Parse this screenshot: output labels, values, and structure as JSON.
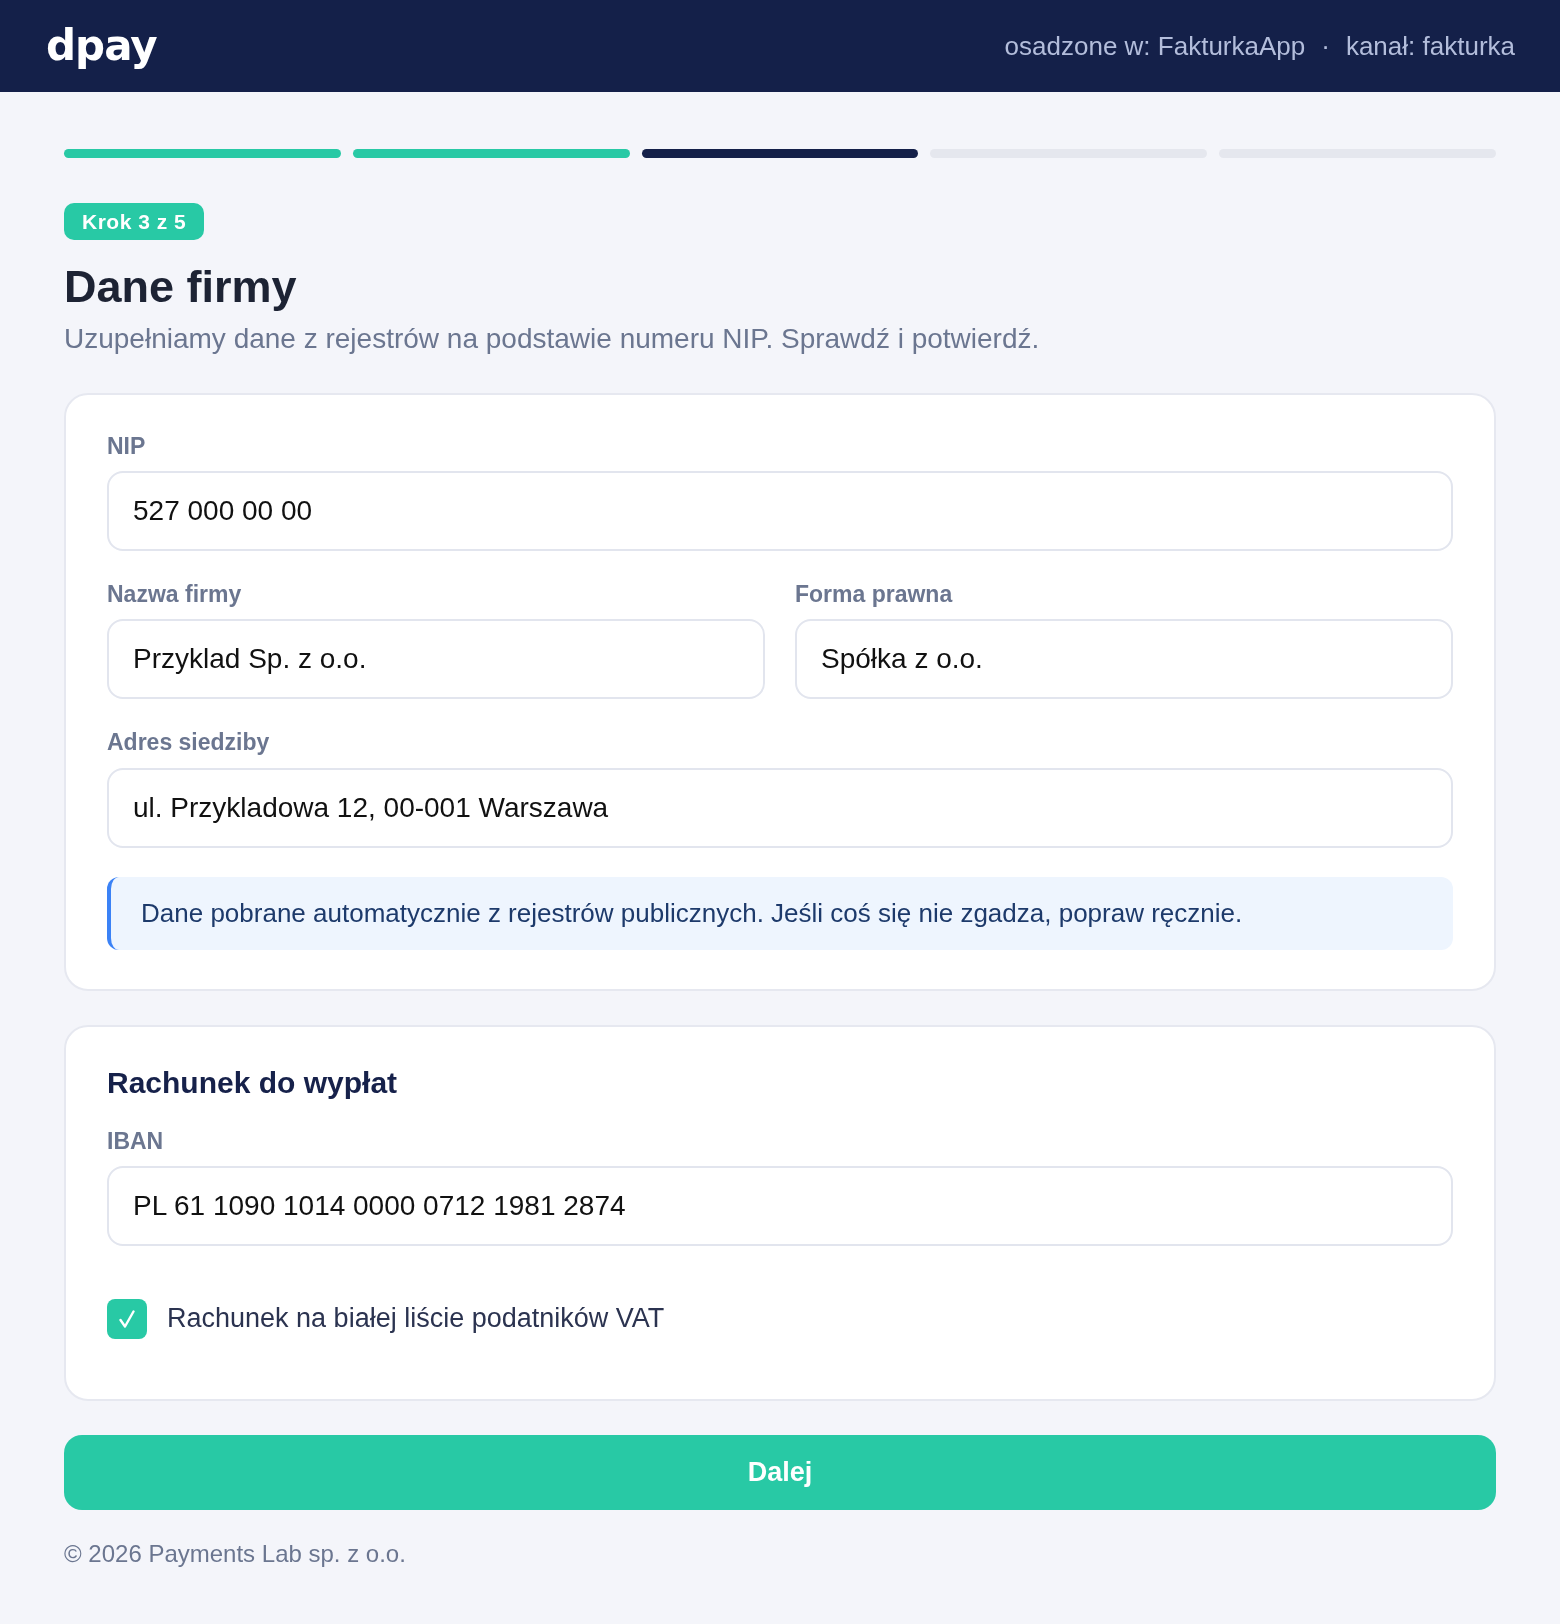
{
  "header": {
    "logo": "dpay",
    "meta": {
      "items": [
        "osadzone w: FakturkaApp",
        "kanał: fakturka"
      ],
      "separator": "·"
    }
  },
  "progress": {
    "steps": [
      {
        "completed": true,
        "current": false
      },
      {
        "completed": true,
        "current": false
      },
      {
        "completed": false,
        "current": true
      },
      {
        "completed": false,
        "current": false
      },
      {
        "completed": false,
        "current": false
      }
    ]
  },
  "step_badge": "Krok 3 z 5",
  "title": "Dane firmy",
  "subtitle": "Uzupełniamy dane z rejestrów na podstawie numeru NIP. Sprawdź i potwierdź.",
  "company_card": {
    "rows": [
      [
        {
          "label": "NIP",
          "value": "527 000 00 00"
        }
      ],
      [
        {
          "label": "Nazwa firmy",
          "value": "Przyklad Sp. z o.o."
        },
        {
          "label": "Forma prawna",
          "value": "Spółka z o.o."
        }
      ],
      [
        {
          "label": "Adres siedziby",
          "value": "ul. Przykladowa 12, 00-001 Warszawa"
        }
      ]
    ],
    "notice": "Dane pobrane automatycznie z rejestrów publicznych. Jeśli coś się nie zgadza, popraw ręcznie."
  },
  "payout_card": {
    "heading": "Rachunek do wypłat",
    "rows": [
      [
        {
          "label": "IBAN",
          "value": "PL 61 1090 1014 0000 0712 1981 2874"
        }
      ]
    ],
    "checkbox": {
      "label": "Rachunek na białej liście podatników VAT",
      "checked": true
    }
  },
  "primary_button": "Dalej",
  "footer": "© 2026 Payments Lab sp. z o.o."
}
